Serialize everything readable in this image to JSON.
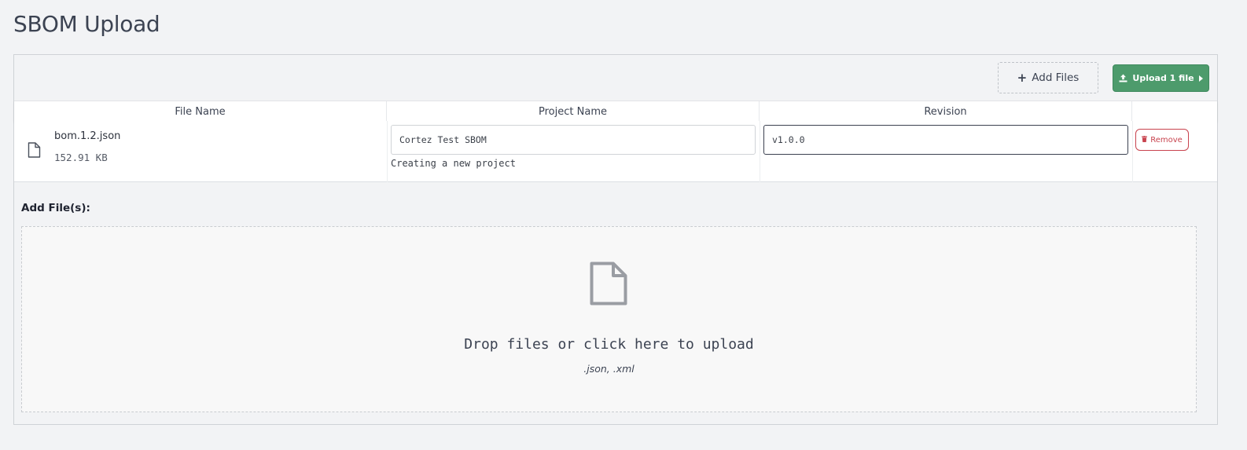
{
  "page": {
    "title": "SBOM Upload"
  },
  "toolbar": {
    "add_files_label": "Add Files",
    "add_files_icon": "plus-icon",
    "upload_label": "Upload 1 file",
    "upload_icon": "upload-icon",
    "upload_caret_icon": "caret-right-icon",
    "upload_color": "#4d9b6c"
  },
  "table": {
    "headers": [
      "File Name",
      "Project Name",
      "Revision"
    ],
    "rows": [
      {
        "file_icon": "file-icon",
        "file_name": "bom.1.2.json",
        "file_size": "152.91 KB",
        "project_name": "Cortez Test SBOM",
        "project_note": "Creating a new project",
        "revision": "v1.0.0",
        "remove_label": "Remove",
        "remove_icon": "trash-icon",
        "remove_color": "#c8434e"
      }
    ]
  },
  "dropzone": {
    "label": "Add File(s):",
    "icon": "file-icon",
    "text": "Drop files or click here to upload",
    "types": ".json, .xml"
  }
}
